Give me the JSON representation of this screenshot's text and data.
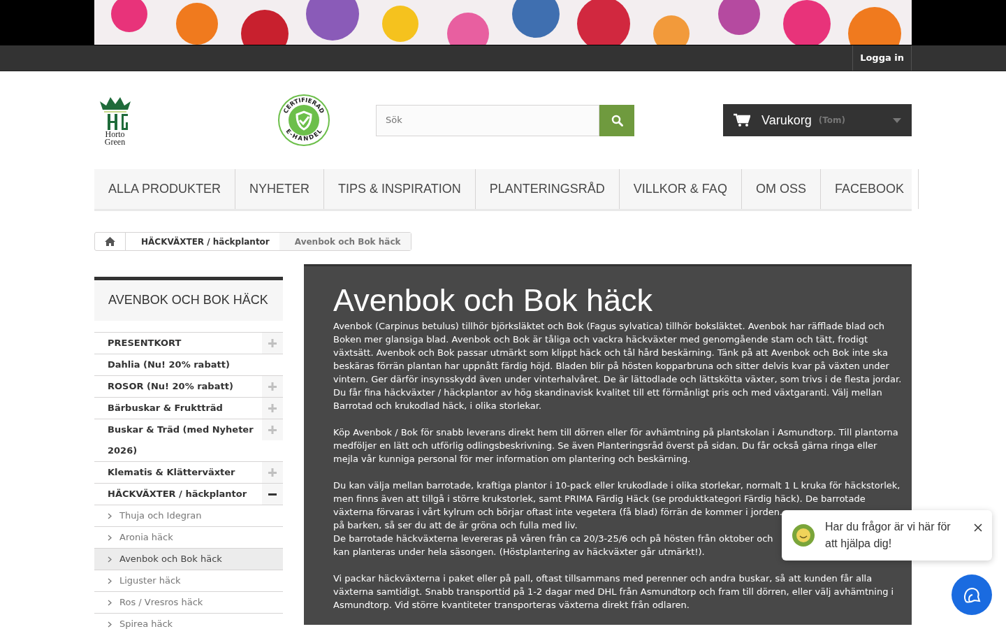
{
  "topbar": {
    "login": "Logga in"
  },
  "logo": {
    "lines": [
      "Horto",
      "Green"
    ]
  },
  "badge": {
    "top": "CERTIFIERAD",
    "bottom": "E-HANDEL"
  },
  "search": {
    "placeholder": "Sök"
  },
  "cart": {
    "label": "Varukorg",
    "count": "(Tom)"
  },
  "nav": [
    "ALLA PRODUKTER",
    "NYHETER",
    "TIPS & INSPIRATION",
    "PLANTERINGSRÅD",
    "VILLKOR & FAQ",
    "OM OSS",
    "FACEBOOK"
  ],
  "breadcrumb": [
    {
      "kind": "home"
    },
    {
      "kind": "link",
      "label": "HÄCKVÄXTER / häckplantor"
    },
    {
      "kind": "current",
      "label": "Avenbok och Bok häck"
    }
  ],
  "sidebar": {
    "title": "AVENBOK OCH BOK HÄCK",
    "categories": [
      {
        "label": "PRESENTKORT",
        "has_children": true,
        "expanded": false
      },
      {
        "label": "Dahlia (Nu! 20% rabatt)",
        "has_children": false
      },
      {
        "label": "ROSOR (Nu! 20% rabatt)",
        "has_children": true,
        "expanded": false
      },
      {
        "label": "Bärbuskar & Fruktträd",
        "has_children": true,
        "expanded": false
      },
      {
        "label": "Buskar & Träd (med Nyheter 2026)",
        "has_children": true,
        "expanded": false
      },
      {
        "label": "Klematis & Klätterväxter",
        "has_children": true,
        "expanded": false
      },
      {
        "label": "HÄCKVÄXTER / häckplantor",
        "has_children": true,
        "expanded": true,
        "children": [
          {
            "label": "Thuja och Idegran",
            "selected": false
          },
          {
            "label": "Aronia häck",
            "selected": false
          },
          {
            "label": "Avenbok och Bok häck",
            "selected": true
          },
          {
            "label": "Liguster häck",
            "selected": false
          },
          {
            "label": "Ros / Vresros häck",
            "selected": false
          },
          {
            "label": "Spirea häck",
            "selected": false
          }
        ]
      }
    ]
  },
  "content": {
    "title": "Avenbok och Bok häck",
    "paragraphs": [
      [
        "Avenbok (Carpinus betulus) tillhör björksläktet och Bok (Fagus sylvatica) tillhör boksläktet. Avenbok har räfflade blad och",
        "Boken mer glansiga blad. Avenbok och Bok är tåliga och vackra häckväxter med genomgående stam och tätt, frodigt",
        "växtsätt. Avenbok och Bok passar utmärkt som klippt häck och tål hård beskärning. Tänk på att Avenbok och Bok inte ska",
        "beskäras förrän plantan har uppnått färdig höjd. Bladen blir på hösten kopparbruna och sitter delvis kvar på växten under",
        "vintern. Ger därför insynsskydd även under vinterhalvåret. De är lättodlade och lättskötta växter, som trivs i de flesta jordar.",
        "Du får fina häckväxter / häckplantor av hög skandinavisk kvalitet till ett förmånligt pris och med växtgaranti. Välj mellan",
        "Barrotad och krukodlad häck, i olika storlekar."
      ],
      [
        "Köp Avenbok / Bok för snabb leverans direkt hem till dörren eller för avhämtning på plantskolan i Asmundtorp. Till plantorna",
        "medföljer en lätt och utförlig odlingsbeskrivning. Se även Planteringsråd överst på sidan. Du får också gärna ringa eller",
        "mejla vår kunniga personal för mer information om plantering och beskärning."
      ],
      [
        "Du kan välja mellan barrotade, kraftiga plantor i 10-pack eller krukodlade i olika storlekar, normalt 1 L kruka för häckstorlek,",
        "men finns även att tillgå i större krukstorlek, samt PRIMA Färdig Häck (se produktkategori Färdig häck). De barrotade",
        "växterna förvaras i vårt kylrum och börjar oftast inte vegetera (få blad) förrän de kommer i jorden.",
        "på barken, så ser du att de är gröna och fulla med liv.",
        "De barrotade häckväxterna levereras på våren från ca 20/3-25/6 och på hösten från oktober och",
        "kan planteras under hela säsongen. (Höstplantering av häckväxter går utmärkt!)."
      ],
      [
        "Vi packar häckväxterna i paket eller på pall, oftast tillsammans med perenner och andra buskar, så att kunden får alla",
        "växterna samtidigt. Snabb transporttid på 1-2 dagar med DHL från Asmundtorp och fram till dörren, eller välj avhämtning i",
        "Asmundtorp. Vid större kvantiteter transporteras växterna direkt från odlaren."
      ]
    ]
  },
  "chat": {
    "message": "Har du frågor är vi här för att hjälpa dig!"
  }
}
